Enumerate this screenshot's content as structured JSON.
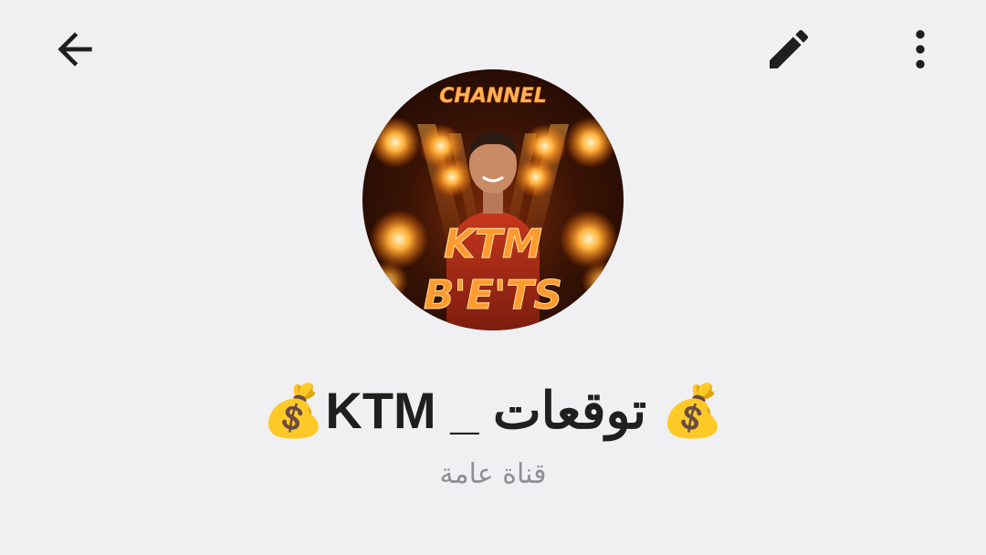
{
  "header": {
    "back_icon": "arrow-left-icon",
    "edit_icon": "pencil-icon",
    "more_icon": "more-vertical-icon"
  },
  "profile": {
    "avatar_caption_top": "CHANNEL",
    "avatar_caption_line1": "KTM",
    "avatar_caption_line2": "B'E'TS",
    "title": "💰 توقعات _ KTM💰",
    "subtitle": "قناة عامة"
  },
  "colors": {
    "background": "#f0f0f2",
    "icon": "#1f1f1f",
    "title": "#1f1f1f",
    "subtitle": "#8e8e93",
    "avatar_glow": "#ff8a1c"
  }
}
